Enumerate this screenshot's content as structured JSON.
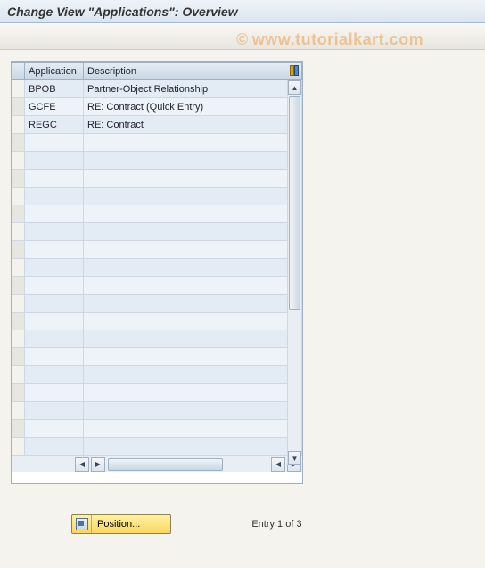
{
  "window": {
    "title": "Change View \"Applications\": Overview"
  },
  "watermark": "www.tutorialkart.com",
  "table": {
    "columns": {
      "application": "Application",
      "description": "Description"
    },
    "rows": [
      {
        "app": "BPOB",
        "desc": "Partner-Object Relationship"
      },
      {
        "app": "GCFE",
        "desc": "RE: Contract (Quick Entry)"
      },
      {
        "app": "REGC",
        "desc": "RE: Contract"
      },
      {
        "app": "",
        "desc": ""
      },
      {
        "app": "",
        "desc": ""
      },
      {
        "app": "",
        "desc": ""
      },
      {
        "app": "",
        "desc": ""
      },
      {
        "app": "",
        "desc": ""
      },
      {
        "app": "",
        "desc": ""
      },
      {
        "app": "",
        "desc": ""
      },
      {
        "app": "",
        "desc": ""
      },
      {
        "app": "",
        "desc": ""
      },
      {
        "app": "",
        "desc": ""
      },
      {
        "app": "",
        "desc": ""
      },
      {
        "app": "",
        "desc": ""
      },
      {
        "app": "",
        "desc": ""
      },
      {
        "app": "",
        "desc": ""
      },
      {
        "app": "",
        "desc": ""
      },
      {
        "app": "",
        "desc": ""
      },
      {
        "app": "",
        "desc": ""
      },
      {
        "app": "",
        "desc": ""
      }
    ]
  },
  "footer": {
    "position_button": "Position...",
    "entry_text": "Entry 1 of 3"
  }
}
